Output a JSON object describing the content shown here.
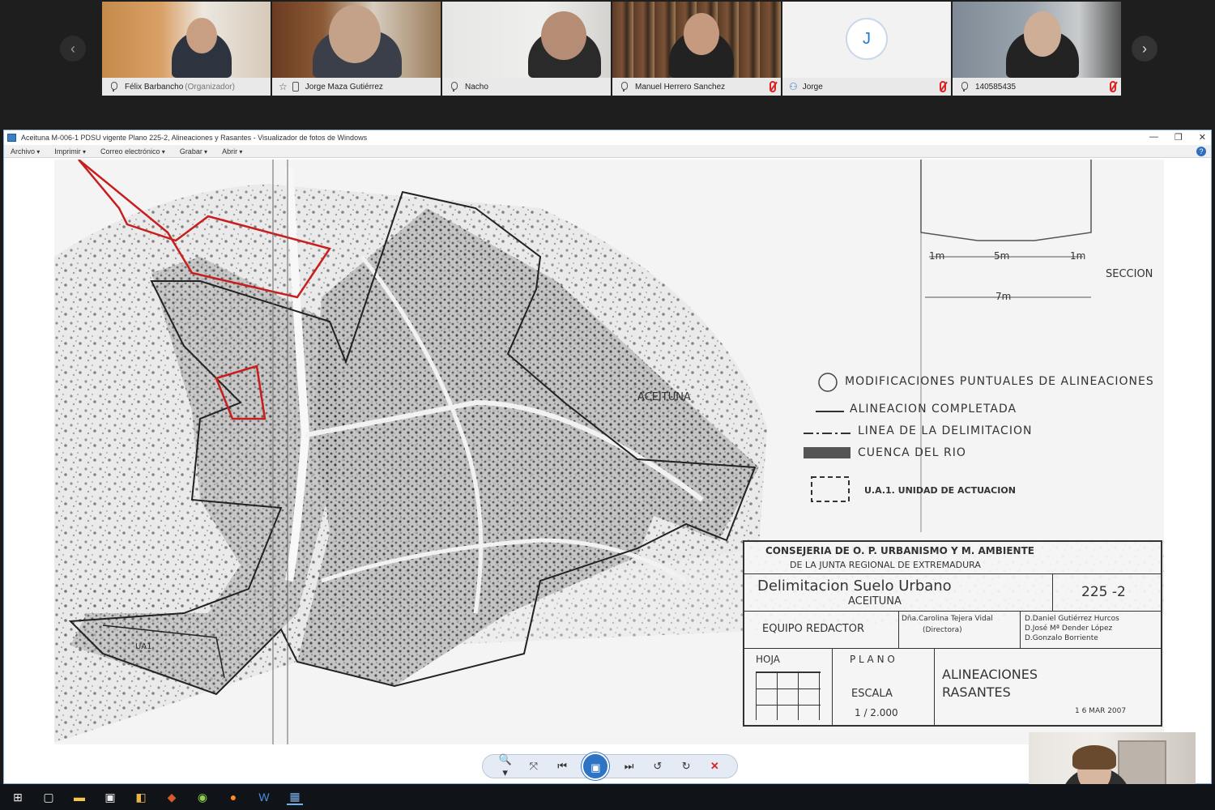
{
  "meeting": {
    "participants": [
      {
        "name": "Félix Barbancho",
        "role": "(Organizador)"
      },
      {
        "name": "Jorge Maza Gutiérrez"
      },
      {
        "name": "Nacho"
      },
      {
        "name": "Manuel Herrero Sanchez"
      },
      {
        "name": "Jorge",
        "avatar_initial": "J"
      },
      {
        "name": "140585435"
      }
    ],
    "prev_arrow": "‹",
    "next_arrow": "›"
  },
  "viewer": {
    "title": "Aceituna M-006-1 PDSU vigente Plano 225-2, Alineaciones y Rasantes - Visualizador de fotos de Windows",
    "window_controls": [
      "—",
      "❐",
      "✕"
    ],
    "menu": [
      "Archivo",
      "Imprimir",
      "Correo electrónico",
      "Grabar",
      "Abrir"
    ],
    "help": "?",
    "controls": {
      "zoom": "🔍▾",
      "fit": "⤧",
      "prev": "⏮",
      "slideshow": "▣",
      "next": "⏭",
      "rotate_ccw": "↺",
      "rotate_cw": "↻",
      "delete": "✕"
    }
  },
  "map": {
    "section_dims": {
      "left": "1m",
      "middle": "5m",
      "right": "1m",
      "total": "7m"
    },
    "section_label": "SECCION",
    "town_label": "ACEITUNA",
    "zone_label": "UA1",
    "legend": [
      "MODIFICACIONES   PUNTUALES  DE  ALINEACIONES",
      "ALINEACION   COMPLETADA",
      "LINEA DE LA  DELIMITACION",
      "CUENCA  DEL  RIO",
      "U.A.1. UNIDAD DE ACTUACION"
    ],
    "title_block": {
      "authority_line1": "CONSEJERIA  DE  O. P.  URBANISMO  Y  M. AMBIENTE",
      "authority_line2": "DE  LA  JUNTA  REGIONAL  DE  EXTREMADURA",
      "project": "Delimitacion  Suelo  Urbano",
      "town": "ACEITUNA",
      "plan_number": "225 -2",
      "team_label": "EQUIPO  REDACTOR",
      "director": "Dña.Carolina Tejera Vidal",
      "director_role": "(Directora)",
      "members": [
        "D.Daniel Gutiérrez Hurcos",
        "D.José Mª Dender López",
        "D.Gonzalo Borriente"
      ],
      "sheet_label": "HOJA",
      "plan_label": "P L A N O",
      "plan_title_1": "ALINEACIONES",
      "plan_title_2": "RASANTES",
      "scale_label": "ESCALA",
      "scale_value": "1 / 2.000",
      "date": "1 6  MAR  2007"
    }
  },
  "taskbar": {
    "start_icon": "⊞",
    "icons": [
      "task-view-icon",
      "file-explorer-icon",
      "store-icon",
      "app-icon",
      "media-icon",
      "browser-icon",
      "firefox-icon",
      "word-icon",
      "photos-icon"
    ]
  }
}
